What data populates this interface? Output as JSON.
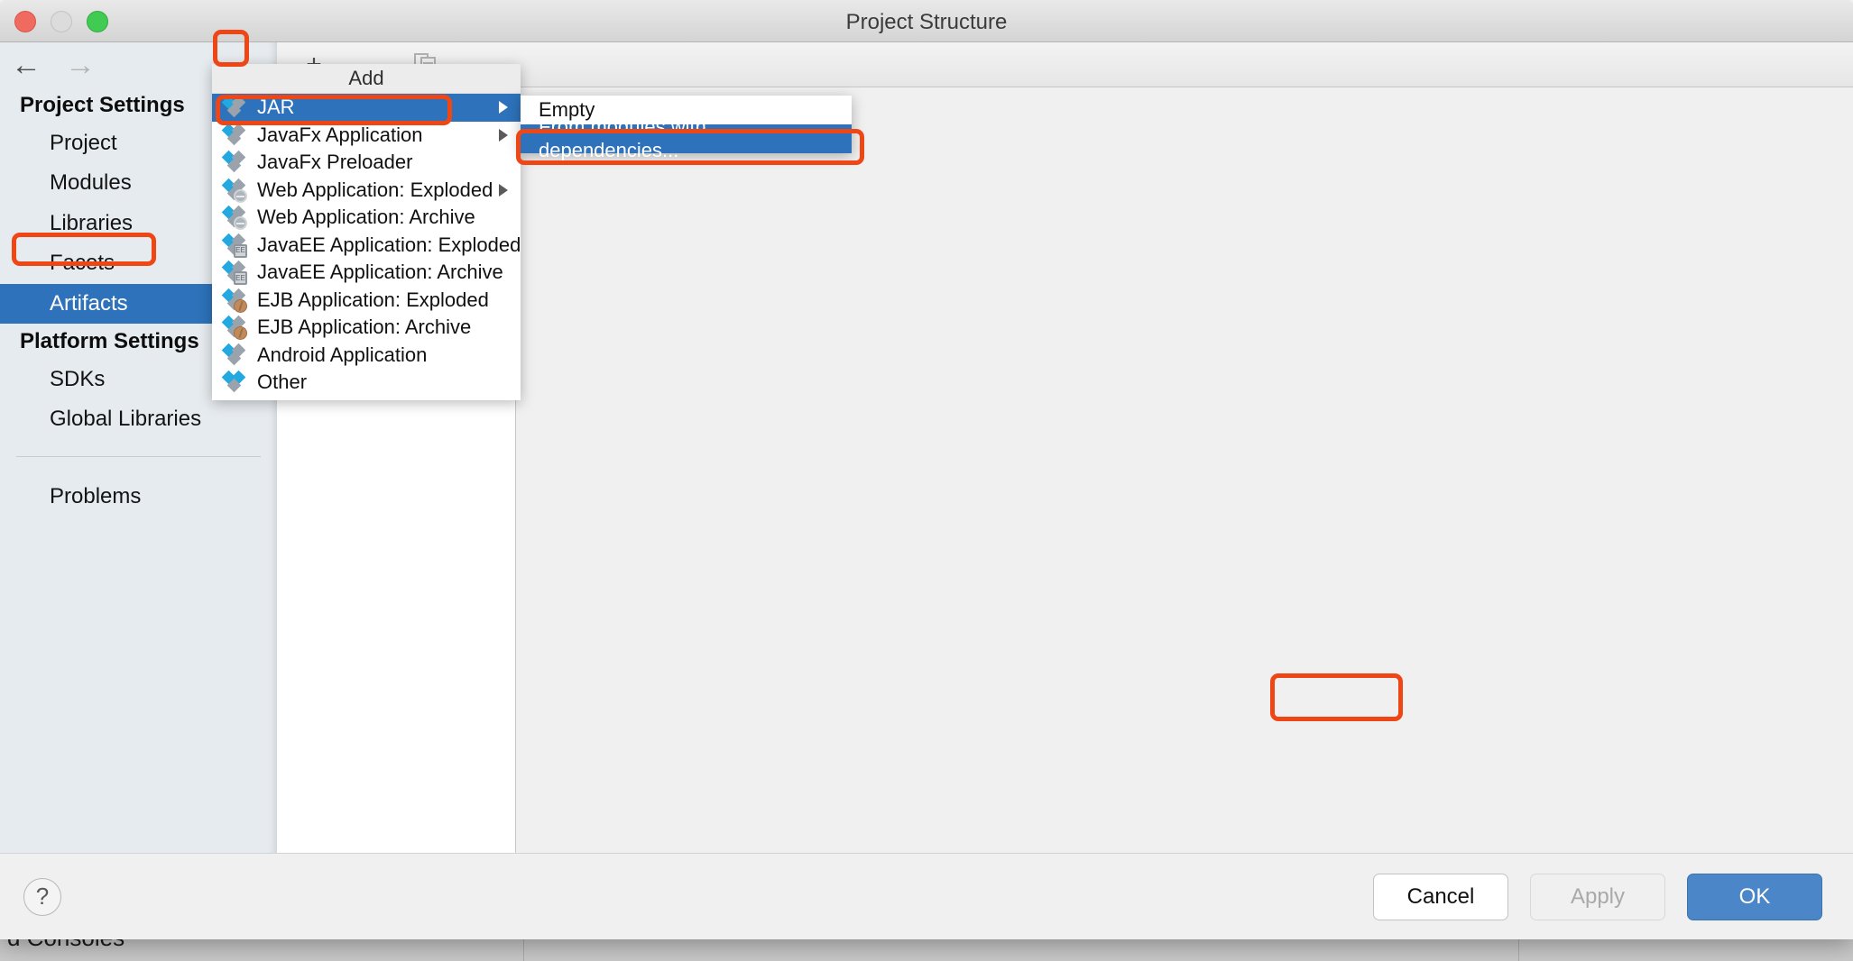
{
  "window": {
    "title": "Project Structure",
    "traffic_lights": [
      "close",
      "minimize",
      "maximize"
    ]
  },
  "nav": {
    "back_icon": "arrow-left-icon",
    "forward_icon": "arrow-right-icon"
  },
  "sidebar": {
    "groups": [
      {
        "title": "Project Settings",
        "items": [
          {
            "label": "Project",
            "selected": false
          },
          {
            "label": "Modules",
            "selected": false
          },
          {
            "label": "Libraries",
            "selected": false
          },
          {
            "label": "Facets",
            "selected": false
          },
          {
            "label": "Artifacts",
            "selected": true
          }
        ]
      },
      {
        "title": "Platform Settings",
        "items": [
          {
            "label": "SDKs",
            "selected": false
          },
          {
            "label": "Global Libraries",
            "selected": false
          }
        ]
      }
    ],
    "extra_item": {
      "label": "Problems"
    }
  },
  "toolbar": {
    "add_label": "+",
    "remove_label": "–",
    "copy_icon": "copy-icon"
  },
  "add_menu": {
    "header": "Add",
    "items": [
      {
        "label": "JAR",
        "icon": "artifact-jar-icon",
        "highlighted": true,
        "has_submenu": true
      },
      {
        "label": "JavaFx Application",
        "icon": "artifact-javafx-icon",
        "highlighted": false,
        "has_submenu": true
      },
      {
        "label": "JavaFx Preloader",
        "icon": "artifact-javafx-icon",
        "highlighted": false,
        "has_submenu": false
      },
      {
        "label": "Web Application: Exploded",
        "icon": "artifact-web-icon",
        "highlighted": false,
        "has_submenu": true
      },
      {
        "label": "Web Application: Archive",
        "icon": "artifact-web-icon",
        "highlighted": false,
        "has_submenu": false
      },
      {
        "label": "JavaEE Application: Exploded",
        "icon": "artifact-javaee-icon",
        "highlighted": false,
        "has_submenu": false
      },
      {
        "label": "JavaEE Application: Archive",
        "icon": "artifact-javaee-icon",
        "highlighted": false,
        "has_submenu": false
      },
      {
        "label": "EJB Application: Exploded",
        "icon": "artifact-ejb-icon",
        "highlighted": false,
        "has_submenu": false
      },
      {
        "label": "EJB Application: Archive",
        "icon": "artifact-ejb-icon",
        "highlighted": false,
        "has_submenu": false
      },
      {
        "label": "Android Application",
        "icon": "artifact-android-icon",
        "highlighted": false,
        "has_submenu": false
      },
      {
        "label": "Other",
        "icon": "artifact-other-icon",
        "highlighted": false,
        "has_submenu": false
      }
    ]
  },
  "sub_menu": {
    "items": [
      {
        "label": "Empty",
        "highlighted": false
      },
      {
        "label": "From modules with dependencies...",
        "highlighted": true
      }
    ]
  },
  "footer": {
    "help_label": "?",
    "cancel_label": "Cancel",
    "apply_label": "Apply",
    "ok_label": "OK"
  },
  "background": {
    "bottom_text": "d Consoles"
  },
  "colors": {
    "selection_blue": "#2d72ba",
    "annotation_orange": "#ee4715",
    "primary_button_blue": "#4a86c8",
    "sidebar_bg": "#e6ebef",
    "icon_blue": "#23a8e0",
    "icon_gray": "#9aa3ab"
  }
}
